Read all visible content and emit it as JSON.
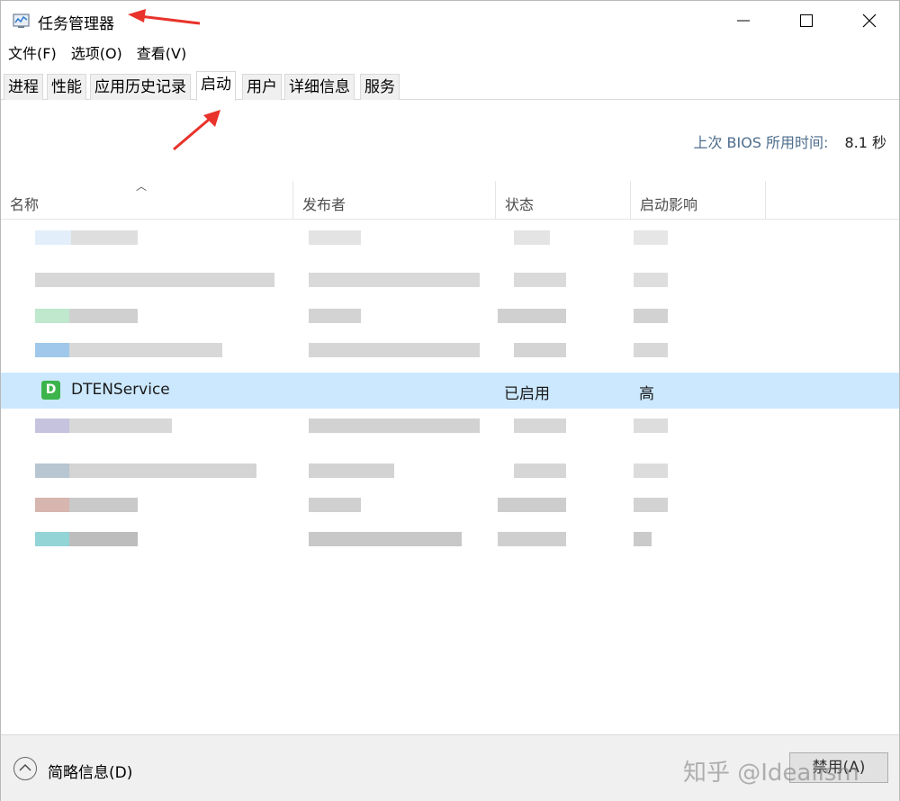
{
  "window": {
    "title": "任务管理器"
  },
  "menu": [
    "文件(F)",
    "选项(O)",
    "查看(V)"
  ],
  "tabs": [
    "进程",
    "性能",
    "应用历史记录",
    "启动",
    "用户",
    "详细信息",
    "服务"
  ],
  "active_tab": "启动",
  "bios": {
    "label": "上次 BIOS 所用时间:",
    "value": "8.1 秒"
  },
  "columns": [
    "名称",
    "发布者",
    "状态",
    "启动影响"
  ],
  "selected_row": {
    "icon_letter": "D",
    "name": "DTENService",
    "publisher": "",
    "status": "已启用",
    "impact": "高"
  },
  "footer": {
    "fewer_details": "简略信息(D)",
    "disable_button": "禁用(A)",
    "watermark": "知乎 @Idealism"
  },
  "colors": {
    "selected_row": "#cce8ff",
    "annotation_arrow": "#e8322a",
    "icon_green": "#3cb44b"
  }
}
